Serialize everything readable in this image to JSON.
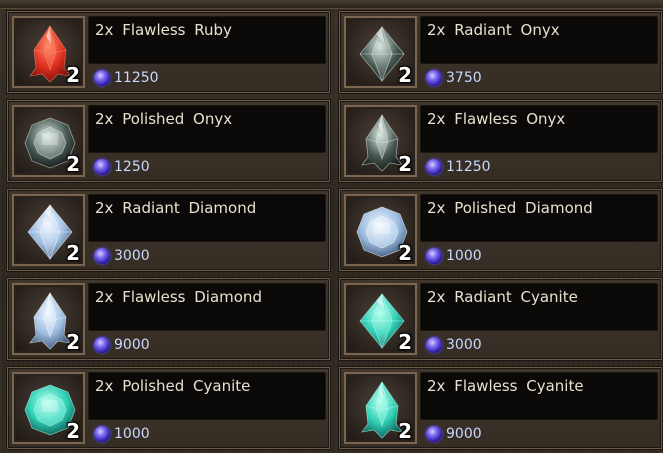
{
  "colors": {
    "ruby": "#d7261b",
    "onyx": "#1c2a26",
    "diamond": "#a9c6e4",
    "cyanite": "#2fd1b8",
    "price_text": "#c8d8ff",
    "name_text": "#e9e1cf"
  },
  "currency_icon": "purple-orb-icon",
  "items": [
    {
      "name": "2x  Flawless  Ruby",
      "qty": "2",
      "price": "11250",
      "gem": "ruby",
      "cut": "flawless"
    },
    {
      "name": "2x  Radiant  Onyx",
      "qty": "2",
      "price": "3750",
      "gem": "onyx",
      "cut": "radiant"
    },
    {
      "name": "2x  Polished  Onyx",
      "qty": "2",
      "price": "1250",
      "gem": "onyx",
      "cut": "polished"
    },
    {
      "name": "2x  Flawless  Onyx",
      "qty": "2",
      "price": "11250",
      "gem": "onyx",
      "cut": "flawless"
    },
    {
      "name": "2x  Radiant  Diamond",
      "qty": "2",
      "price": "3000",
      "gem": "diamond",
      "cut": "radiant"
    },
    {
      "name": "2x  Polished  Diamond",
      "qty": "2",
      "price": "1000",
      "gem": "diamond",
      "cut": "polished"
    },
    {
      "name": "2x  Flawless  Diamond",
      "qty": "2",
      "price": "9000",
      "gem": "diamond",
      "cut": "flawless"
    },
    {
      "name": "2x  Radiant  Cyanite",
      "qty": "2",
      "price": "3000",
      "gem": "cyanite",
      "cut": "radiant"
    },
    {
      "name": "2x  Polished  Cyanite",
      "qty": "2",
      "price": "1000",
      "gem": "cyanite",
      "cut": "polished"
    },
    {
      "name": "2x  Flawless  Cyanite",
      "qty": "2",
      "price": "9000",
      "gem": "cyanite",
      "cut": "flawless"
    }
  ]
}
